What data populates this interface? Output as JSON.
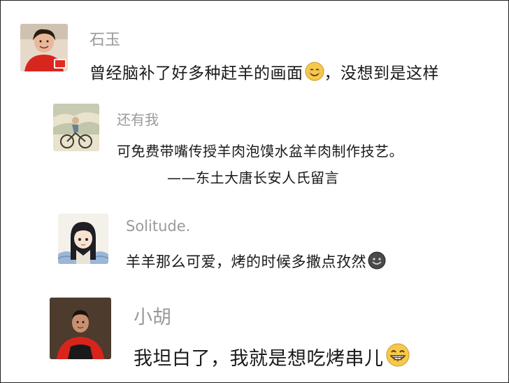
{
  "comments": [
    {
      "name": "石玉",
      "text": "曾经脑补了好多种赶羊的画面",
      "text_after_emoji": "，没想到是这样",
      "emoji": "smile-emoji"
    },
    {
      "name": "还有我",
      "text": "可免费带嘴传授羊肉泡馍水盆羊肉制作技艺。",
      "signature": "——东土大唐长安人氏留言"
    },
    {
      "name": "Solitude.",
      "text": "羊羊那么可爱，烤的时候多撒点孜然",
      "emoji": "dark-grin-emoji"
    },
    {
      "name": "小胡",
      "text": "我坦白了，我就是想吃烤串儿",
      "emoji": "grin-emoji"
    }
  ]
}
